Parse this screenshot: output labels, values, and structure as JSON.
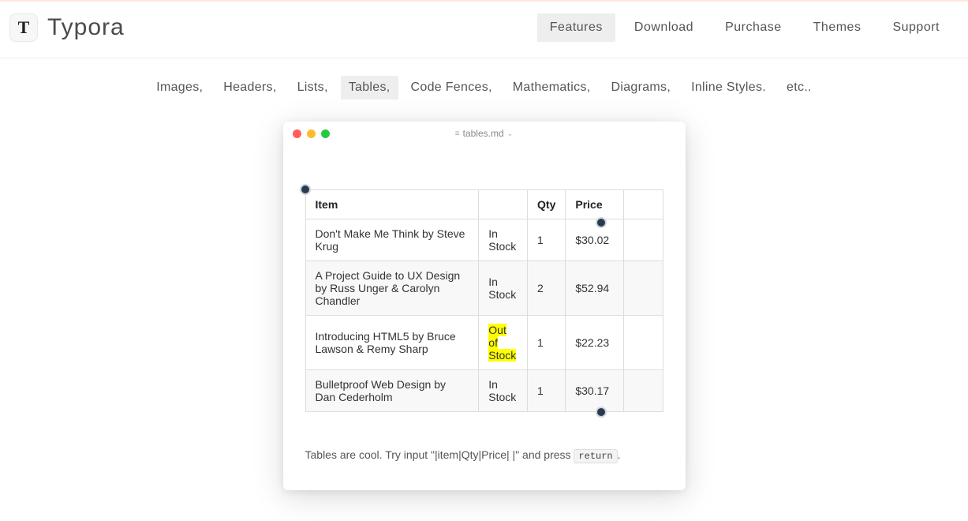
{
  "brand": {
    "logo_letter": "T",
    "name": "Typora"
  },
  "nav": {
    "items": [
      {
        "label": "Features",
        "active": true
      },
      {
        "label": "Download",
        "active": false
      },
      {
        "label": "Purchase",
        "active": false
      },
      {
        "label": "Themes",
        "active": false
      },
      {
        "label": "Support",
        "active": false
      }
    ]
  },
  "feature_tabs": [
    {
      "label": "Images,",
      "active": false
    },
    {
      "label": "Headers,",
      "active": false
    },
    {
      "label": "Lists,",
      "active": false
    },
    {
      "label": "Tables,",
      "active": true
    },
    {
      "label": "Code Fences,",
      "active": false
    },
    {
      "label": "Mathematics,",
      "active": false
    },
    {
      "label": "Diagrams,",
      "active": false
    },
    {
      "label": "Inline Styles.",
      "active": false
    },
    {
      "label": "etc..",
      "active": false
    }
  ],
  "window": {
    "filename": "tables.md"
  },
  "table": {
    "headers": [
      "Item",
      "",
      "Qty",
      "Price",
      ""
    ],
    "rows": [
      {
        "item": "Don't Make Me Think by Steve Krug",
        "stock": "In Stock",
        "out": false,
        "qty": "1",
        "price": "$30.02"
      },
      {
        "item": "A Project Guide to UX Design by Russ Unger & Carolyn Chandler",
        "stock": "In Stock",
        "out": false,
        "qty": "2",
        "price": "$52.94"
      },
      {
        "item": "Introducing HTML5 by Bruce Lawson & Remy Sharp",
        "stock": "Out of Stock",
        "out": true,
        "qty": "1",
        "price": "$22.23"
      },
      {
        "item": "Bulletproof Web Design by Dan Cederholm",
        "stock": "In Stock",
        "out": false,
        "qty": "1",
        "price": "$30.17"
      }
    ]
  },
  "caption": {
    "prefix": "Tables are cool. Try input \"|item|Qty|Price|  |\" and press ",
    "key": "return",
    "suffix": "."
  }
}
